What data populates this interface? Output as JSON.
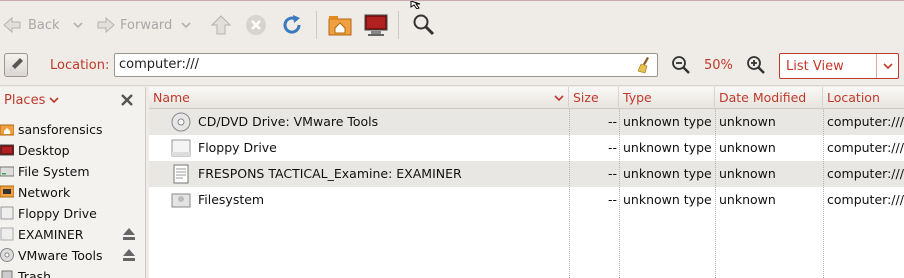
{
  "toolbar": {
    "back_label": "Back",
    "forward_label": "Forward"
  },
  "location": {
    "label": "Location:",
    "value": "computer:///",
    "zoom": "50%",
    "view_mode": "List View"
  },
  "sidebar": {
    "header": "Places",
    "items": [
      {
        "label": "sansforensics",
        "icon": "home-folder-icon"
      },
      {
        "label": "Desktop",
        "icon": "desktop-icon"
      },
      {
        "label": "File System",
        "icon": "harddisk-icon"
      },
      {
        "label": "Network",
        "icon": "network-icon"
      },
      {
        "label": "Floppy Drive",
        "icon": "floppy-icon"
      },
      {
        "label": "EXAMINER",
        "icon": "drive-icon",
        "eject": true
      },
      {
        "label": "VMware Tools",
        "icon": "cdrom-icon",
        "eject": true
      },
      {
        "label": "Trash",
        "icon": "trash-icon"
      }
    ]
  },
  "columns": [
    "Name",
    "Size",
    "Type",
    "Date Modified",
    "Location"
  ],
  "rows": [
    {
      "name": "CD/DVD Drive: VMware Tools",
      "size": "--",
      "type": "unknown type",
      "date": "unknown",
      "location": "computer:///",
      "icon": "cdrom-icon"
    },
    {
      "name": "Floppy Drive",
      "size": "--",
      "type": "unknown type",
      "date": "unknown",
      "location": "computer:///",
      "icon": "floppy-icon"
    },
    {
      "name": "FRESPONS TACTICAL_Examine: EXAMINER",
      "size": "--",
      "type": "unknown type",
      "date": "unknown",
      "location": "computer:///",
      "icon": "document-icon"
    },
    {
      "name": "Filesystem",
      "size": "--",
      "type": "unknown type",
      "date": "unknown",
      "location": "computer:///",
      "icon": "harddisk-icon"
    }
  ],
  "colors": {
    "accent": "#c0392b",
    "alt_row": "#e9e7e4"
  }
}
